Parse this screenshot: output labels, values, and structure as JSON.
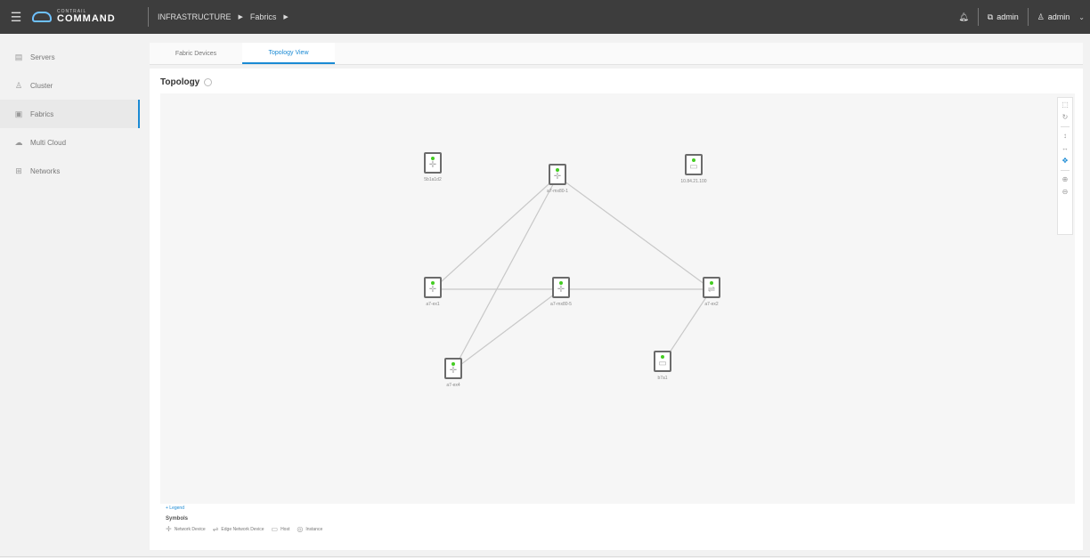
{
  "header": {
    "brand_small": "CONTRAIL",
    "brand_big": "COMMAND",
    "breadcrumb": [
      "INFRASTRUCTURE",
      "Fabrics"
    ],
    "user_cluster": "admin",
    "user_name": "admin"
  },
  "sidebar": {
    "items": [
      {
        "label": "Servers",
        "icon": "server-icon"
      },
      {
        "label": "Cluster",
        "icon": "cluster-icon"
      },
      {
        "label": "Fabrics",
        "icon": "fabric-icon"
      },
      {
        "label": "Multi Cloud",
        "icon": "cloud-icon"
      },
      {
        "label": "Networks",
        "icon": "network-icon"
      }
    ],
    "active": "Fabrics"
  },
  "tabs": [
    "Fabric Devices",
    "Topology View"
  ],
  "active_tab": "Topology View",
  "topology": {
    "title": "Topology",
    "nodes": [
      {
        "id": "n1",
        "label": "5b1a1d2",
        "kind": "network-device"
      },
      {
        "id": "n2",
        "label": "a7-mx80-1",
        "kind": "network-device"
      },
      {
        "id": "n3",
        "label": "10.84.21.100",
        "kind": "host"
      },
      {
        "id": "n4",
        "label": "a7-ex1",
        "kind": "network-device"
      },
      {
        "id": "n5",
        "label": "a7-mx80-5",
        "kind": "network-device"
      },
      {
        "id": "n6",
        "label": "a7-ex2",
        "kind": "edge-network-device"
      },
      {
        "id": "n7",
        "label": "a7-ex4",
        "kind": "network-device"
      },
      {
        "id": "n8",
        "label": "b7a1",
        "kind": "host"
      }
    ],
    "links": [
      [
        "n4",
        "n2"
      ],
      [
        "n7",
        "n2"
      ],
      [
        "n2",
        "n6"
      ],
      [
        "n4",
        "n5"
      ],
      [
        "n5",
        "n6"
      ],
      [
        "n7",
        "n5"
      ],
      [
        "n6",
        "n8"
      ]
    ]
  },
  "legend": {
    "toggle": "+ Legend",
    "title": "Symbols",
    "items": [
      "Network Device",
      "Edge Network Device",
      "Host",
      "Instance"
    ]
  },
  "colors": {
    "accent": "#1a8ad4",
    "status_ok": "#44cc22",
    "topbar": "#3d3d3d"
  }
}
